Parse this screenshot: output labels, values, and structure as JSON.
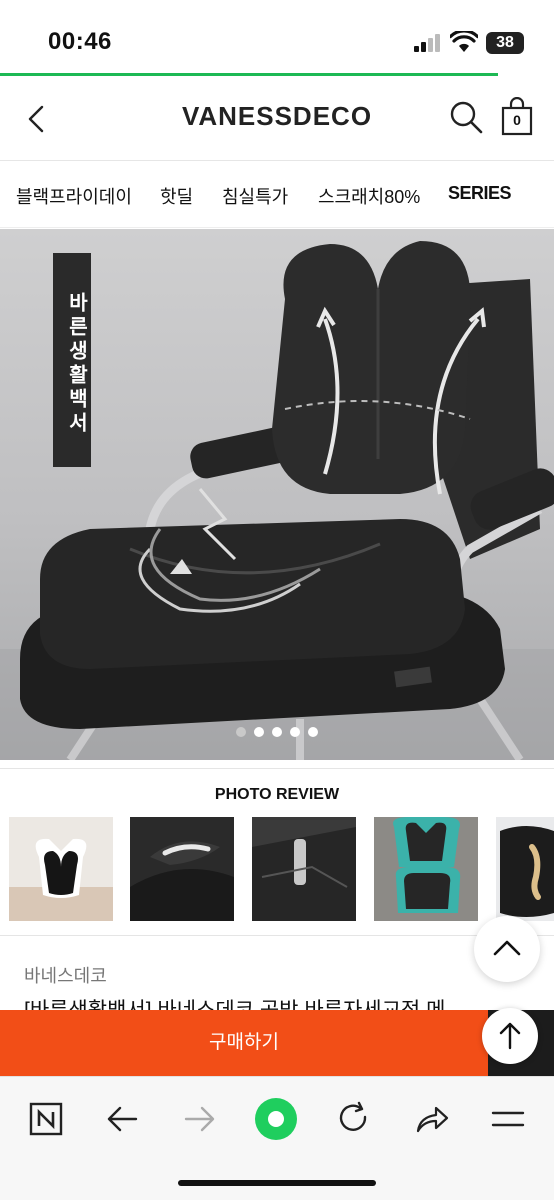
{
  "status_bar": {
    "time": "00:46",
    "battery": "38"
  },
  "header": {
    "logo": "VANESSDECO",
    "cart_count": "0"
  },
  "nav": {
    "items": [
      "블랙프라이데이",
      "핫딜",
      "침실특가",
      "스크래치80%",
      "SERIES"
    ]
  },
  "hero": {
    "banner_text": "바른생활백서",
    "slide_count": 5,
    "active_slide": 0
  },
  "photo_review": {
    "title": "PHOTO REVIEW"
  },
  "product": {
    "brand": "바네스데코",
    "title_partial": "[바른생활백서] 바네스데코 공방 바른자세교정 메"
  },
  "buy_button": {
    "label": "구매하기"
  },
  "colors": {
    "accent_orange": "#f24e17",
    "progress_green": "#1db954",
    "browser_green": "#1fce5e"
  },
  "icons": [
    "back-icon",
    "search-icon",
    "cart-icon",
    "naver-n-icon",
    "arrow-left-icon",
    "arrow-right-icon",
    "browser-home-icon",
    "refresh-icon",
    "share-icon",
    "menu-icon",
    "chevron-up-icon",
    "arrow-up-icon"
  ]
}
